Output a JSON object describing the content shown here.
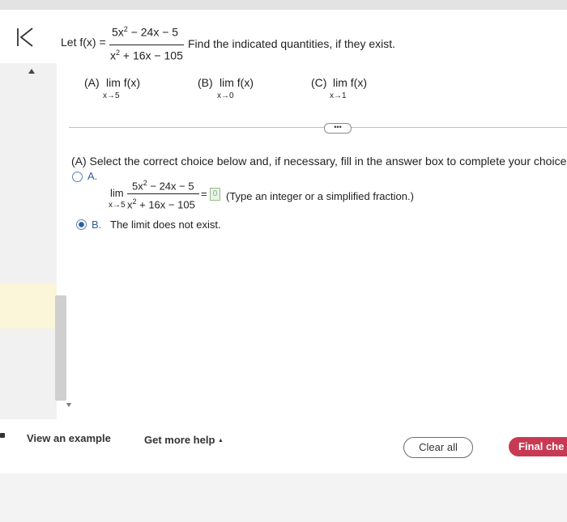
{
  "problem": {
    "let": "Let f(x) =",
    "numerator": "5x",
    "num_exp": "2",
    "numerator_rest": " − 24x − 5",
    "denominator": "x",
    "den_exp": "2",
    "denominator_rest": " + 16x − 105",
    "instruction": "Find the indicated quantities, if they exist."
  },
  "parts": [
    {
      "label": "(A)",
      "lim": "lim f(x)",
      "sub": "x→5"
    },
    {
      "label": "(B)",
      "lim": "lim f(x)",
      "sub": "x→0"
    },
    {
      "label": "(C)",
      "lim": "lim f(x)",
      "sub": "x→1"
    }
  ],
  "expand_dots": "•••",
  "question": {
    "prompt": "(A) Select the correct choice below and, if necessary, fill in the answer box to complete your choice.",
    "choice_a": {
      "letter": "A.",
      "lim": "lim",
      "sub": "x→5",
      "numerator": "5x",
      "num_exp": "2",
      "numerator_rest": " − 24x − 5",
      "denominator": "x",
      "den_exp": "2",
      "denominator_rest": " + 16x − 105",
      "equals": "=",
      "answer_value": "0",
      "hint": "(Type an integer or a simplified fraction.)"
    },
    "choice_b": {
      "letter": "B.",
      "text": "The limit does not exist."
    },
    "selected": "B"
  },
  "footer": {
    "view_example": "View an example",
    "get_help": "Get more help",
    "get_help_caret": "▲",
    "clear_all": "Clear all",
    "final_check": "Final che"
  }
}
